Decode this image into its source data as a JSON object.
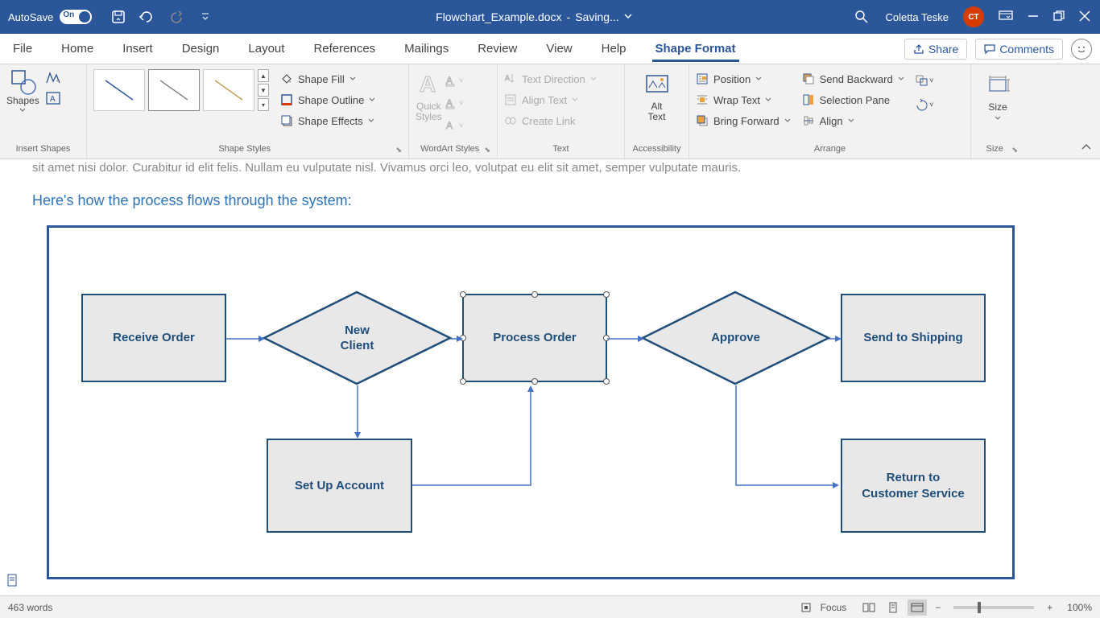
{
  "titlebar": {
    "autosave": "AutoSave",
    "toggle": "On",
    "doc_name": "Flowchart_Example.docx",
    "doc_status": "Saving...",
    "user_name": "Coletta Teske",
    "user_initials": "CT"
  },
  "tabs": {
    "file": "File",
    "home": "Home",
    "insert": "Insert",
    "design": "Design",
    "layout": "Layout",
    "references": "References",
    "mailings": "Mailings",
    "review": "Review",
    "view": "View",
    "help": "Help",
    "shape_format": "Shape Format",
    "share": "Share",
    "comments": "Comments"
  },
  "ribbon": {
    "insert_shapes": {
      "shapes": "Shapes",
      "label": "Insert Shapes"
    },
    "shape_styles": {
      "fill": "Shape Fill",
      "outline": "Shape Outline",
      "effects": "Shape Effects",
      "label": "Shape Styles"
    },
    "wordart": {
      "quick_styles": "Quick\nStyles",
      "label": "WordArt Styles"
    },
    "text": {
      "direction": "Text Direction",
      "align": "Align Text",
      "link": "Create Link",
      "label": "Text"
    },
    "accessibility": {
      "alt_text": "Alt\nText",
      "label": "Accessibility"
    },
    "arrange": {
      "position": "Position",
      "wrap": "Wrap Text",
      "forward": "Bring Forward",
      "backward": "Send Backward",
      "pane": "Selection Pane",
      "align": "Align",
      "label": "Arrange"
    },
    "size": {
      "size": "Size",
      "label": "Size"
    }
  },
  "doc": {
    "body_text": "sit amet nisi dolor. Curabitur id elit felis. Nullam eu vulputate nisl. Vivamus orci leo, volutpat eu elit sit amet, semper vulputate mauris.",
    "heading": "Here's how the process flows through the system:",
    "shapes": {
      "receive": "Receive Order",
      "new_client": "New\nClient",
      "process": "Process Order",
      "approve": "Approve",
      "shipping": "Send to Shipping",
      "setup": "Set Up Account",
      "return": "Return to\nCustomer Service"
    }
  },
  "status": {
    "words": "463 words",
    "focus": "Focus",
    "zoom": "100%"
  },
  "chart_data": {
    "type": "flowchart",
    "nodes": [
      {
        "id": "receive",
        "type": "process",
        "label": "Receive Order"
      },
      {
        "id": "new_client",
        "type": "decision",
        "label": "New Client"
      },
      {
        "id": "process",
        "type": "process",
        "label": "Process Order"
      },
      {
        "id": "approve",
        "type": "decision",
        "label": "Approve"
      },
      {
        "id": "shipping",
        "type": "process",
        "label": "Send to Shipping"
      },
      {
        "id": "setup",
        "type": "process",
        "label": "Set Up Account"
      },
      {
        "id": "return",
        "type": "process",
        "label": "Return to Customer Service"
      }
    ],
    "edges": [
      {
        "from": "receive",
        "to": "new_client"
      },
      {
        "from": "new_client",
        "to": "process"
      },
      {
        "from": "new_client",
        "to": "setup"
      },
      {
        "from": "setup",
        "to": "process"
      },
      {
        "from": "process",
        "to": "approve"
      },
      {
        "from": "approve",
        "to": "shipping"
      },
      {
        "from": "approve",
        "to": "return"
      }
    ]
  }
}
